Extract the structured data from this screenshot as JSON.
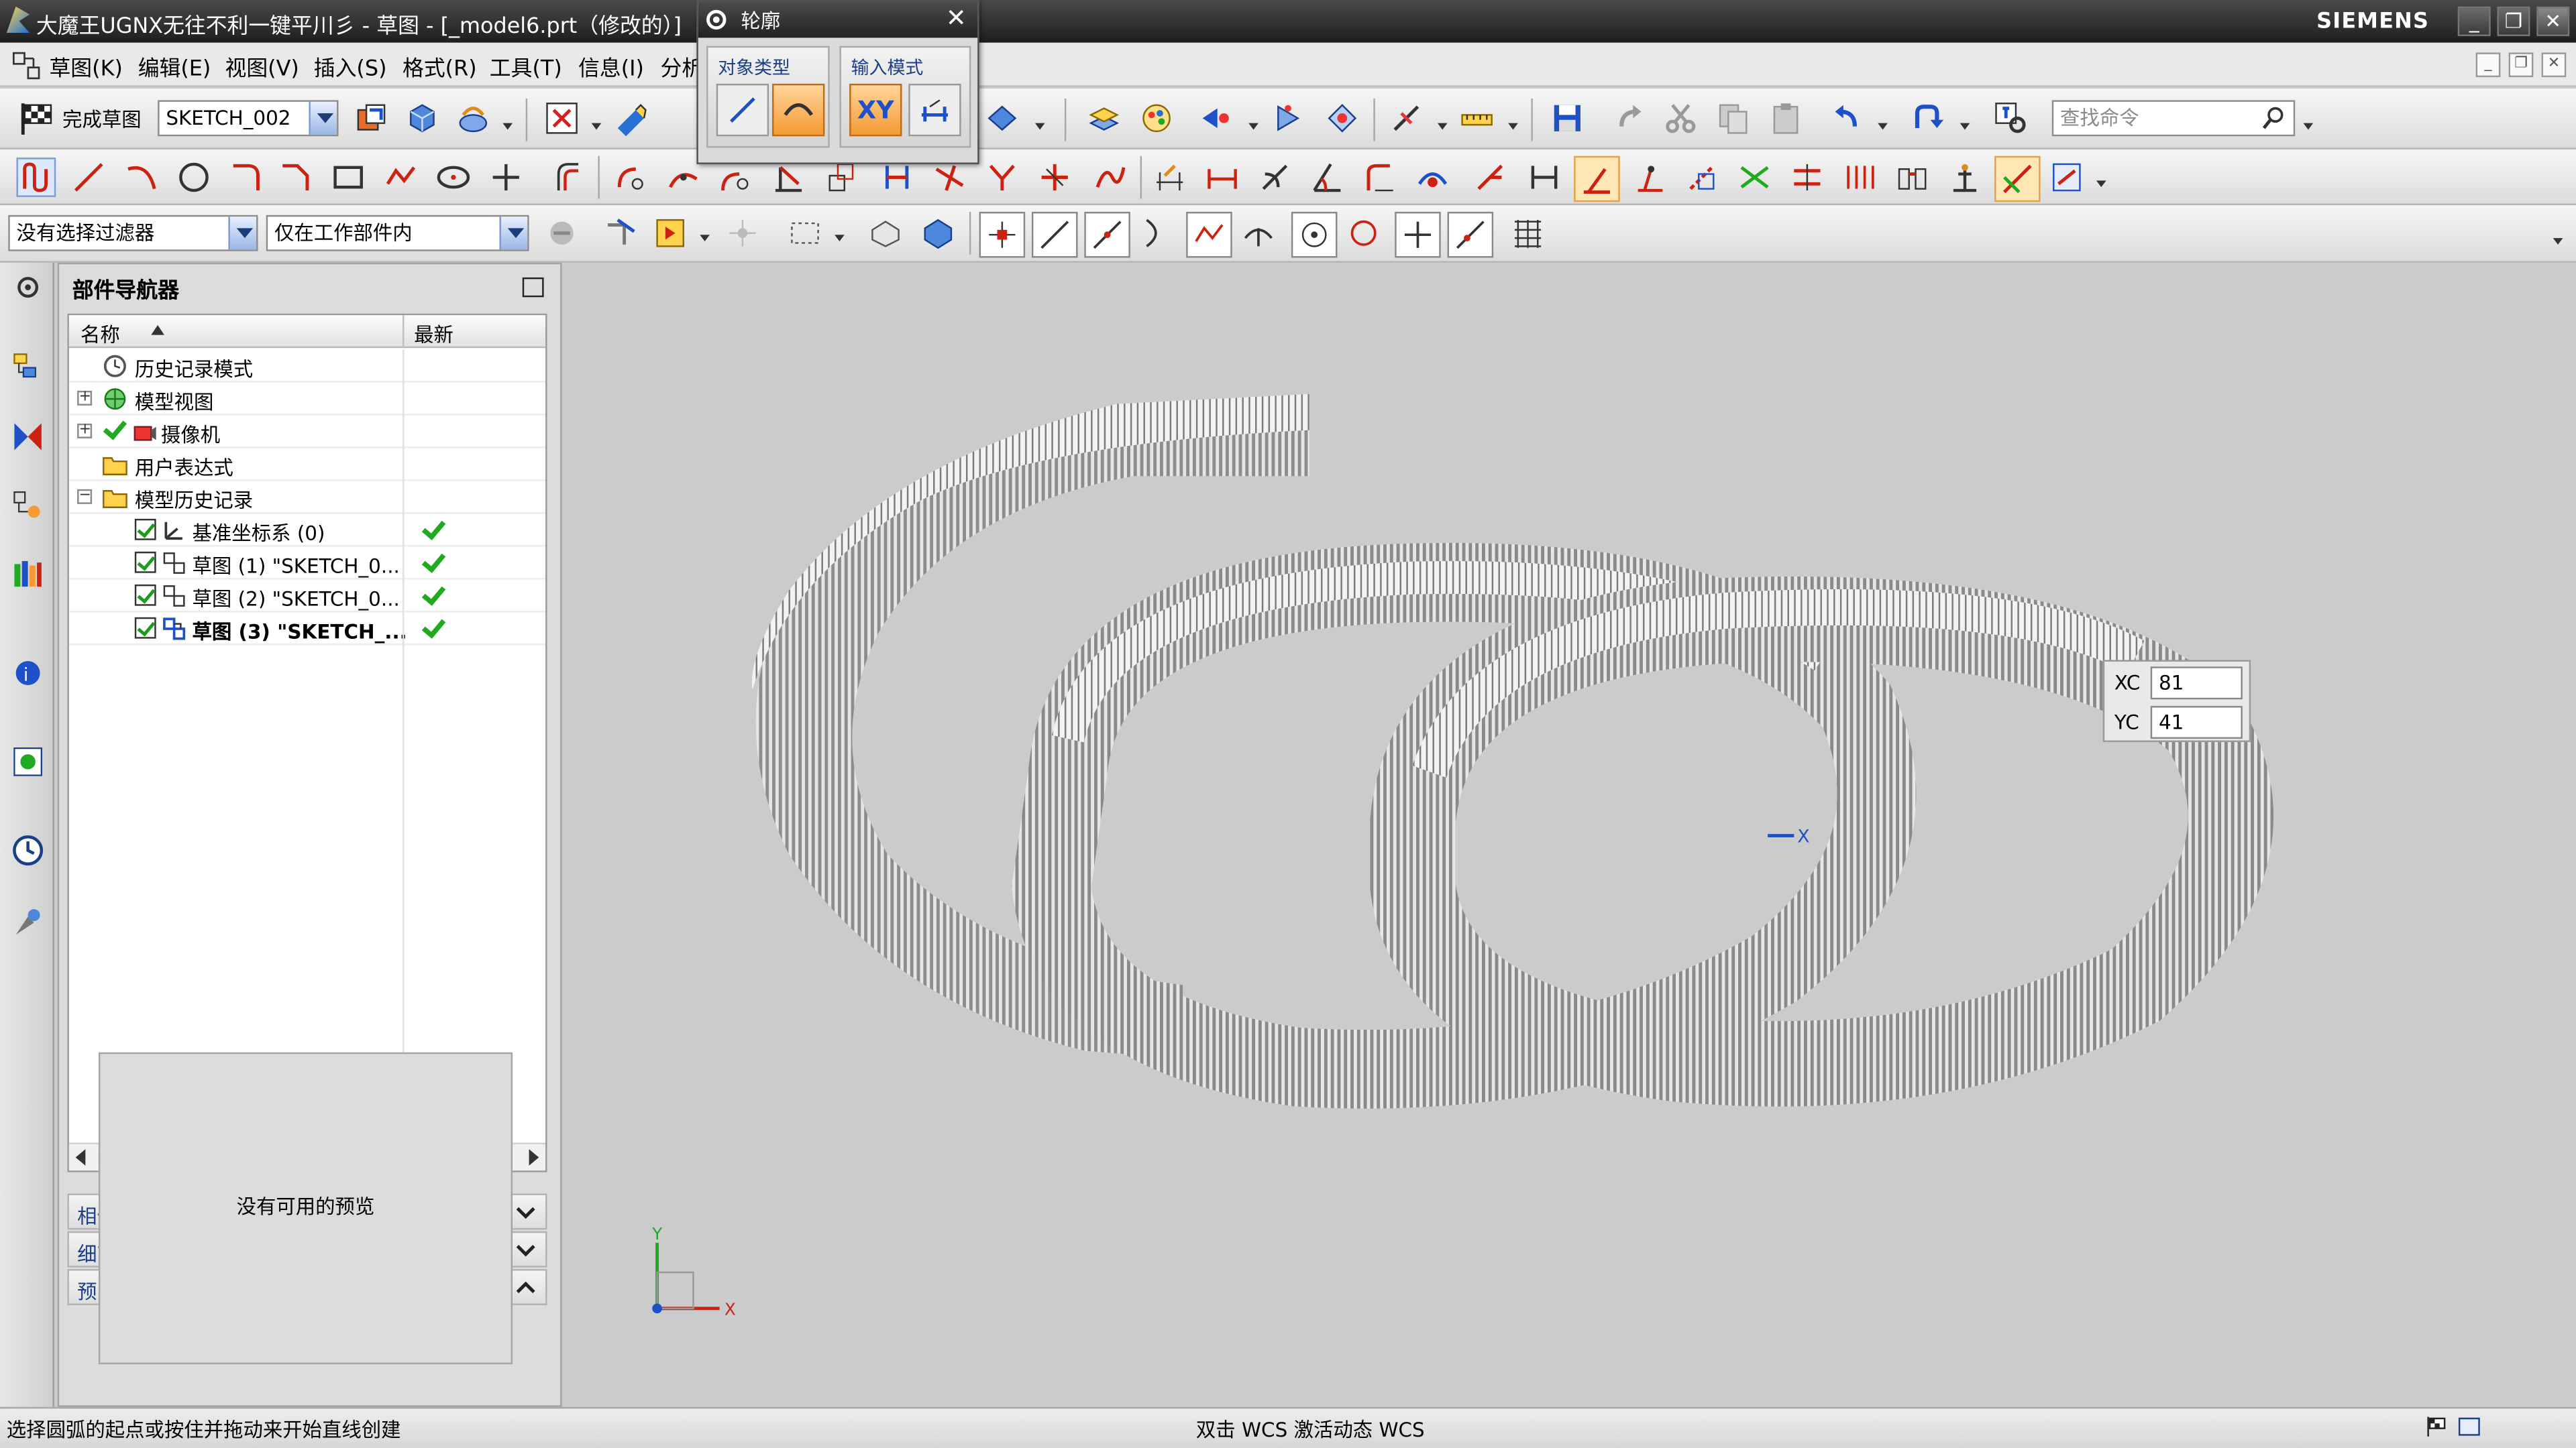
{
  "window": {
    "title": "大魔王UGNX无往不利一键平川彡 - 草图 - [_model6.prt（修改的）]",
    "brand": "SIEMENS"
  },
  "menu": {
    "items": [
      "草图(K)",
      "编辑(E)",
      "视图(V)",
      "插入(S)",
      "格式(R)",
      "工具(T)",
      "信息(I)",
      "分析"
    ]
  },
  "toolbar": {
    "finish_sketch": "完成草图",
    "sketch_name": "SKETCH_002",
    "search_placeholder": "查找命令"
  },
  "selection_bar": {
    "filter": "没有选择过滤器",
    "scope": "仅在工作部件内"
  },
  "contour_dialog": {
    "title": "轮廓",
    "object_type_label": "对象类型",
    "input_mode_label": "输入模式",
    "xy_label": "XY"
  },
  "navigator": {
    "title": "部件导航器",
    "col_name": "名称",
    "col_latest": "最新",
    "rows": [
      {
        "label": "历史记录模式"
      },
      {
        "label": "模型视图"
      },
      {
        "label": "摄像机"
      },
      {
        "label": "用户表达式"
      },
      {
        "label": "模型历史记录"
      },
      {
        "label": "基准坐标系 (0)"
      },
      {
        "label": "草图 (1) \"SKETCH_0..."
      },
      {
        "label": "草图 (2) \"SKETCH_0..."
      },
      {
        "label": "草图 (3) \"SKETCH_..."
      }
    ],
    "panels": {
      "dependency": "相依性",
      "details": "细节",
      "preview": "预览"
    },
    "no_preview": "没有可用的预览"
  },
  "coord_input": {
    "xc_label": "XC",
    "xc_value": "81",
    "yc_label": "YC",
    "yc_value": "41"
  },
  "axis": {
    "x": "X",
    "y": "Y"
  },
  "status": {
    "prompt": "选择圆弧的起点或按住并拖动来开始直线创建",
    "wcs": "双击 WCS 激活动态 WCS"
  },
  "colors": {
    "title_bg": "#2b2b2b",
    "accent_orange": "#f59a34",
    "check_green": "#1faa1f",
    "label_blue": "#1c3f86"
  }
}
